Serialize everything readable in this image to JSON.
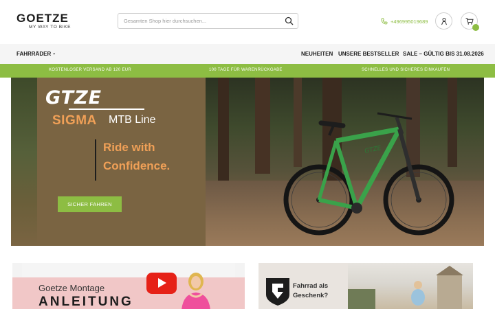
{
  "header": {
    "logo_word": "GOETZE",
    "logo_slogan": "MY WAY TO BIKE",
    "search_placeholder": "Gesamten Shop hier durchsuchen...",
    "phone": "+496995019689"
  },
  "nav": {
    "fahrraeder": "FAHRRÄDER",
    "neuheiten": "NEUHEITEN",
    "bestseller": "UNSERE BESTSELLER",
    "sale": "SALE – GÜLTIG BIS 31.08.2026"
  },
  "usp": {
    "item1": "KOSTENLOSER VERSAND AB 120 EUR",
    "item2": "100 TAGE FÜR WARENRÜCKGABE",
    "item3": "SCHNELLES UND SICHERES EINKAUFEN"
  },
  "hero": {
    "brand": "GTZE",
    "model": "SIGMA",
    "line": "MTB Line",
    "tagline_1": "Ride with",
    "tagline_2": "Confidence.",
    "cta": "SICHER FAHREN"
  },
  "teaser_left": {
    "title": "Goetze Montage",
    "big": "ANLEITUNG"
  },
  "teaser_right": {
    "line1": "Fahrrad als",
    "line2": "Geschenk?"
  },
  "colors": {
    "accent_green": "#8dbd43",
    "hero_orange": "#f0a057",
    "hero_panel": "#7a6442"
  }
}
